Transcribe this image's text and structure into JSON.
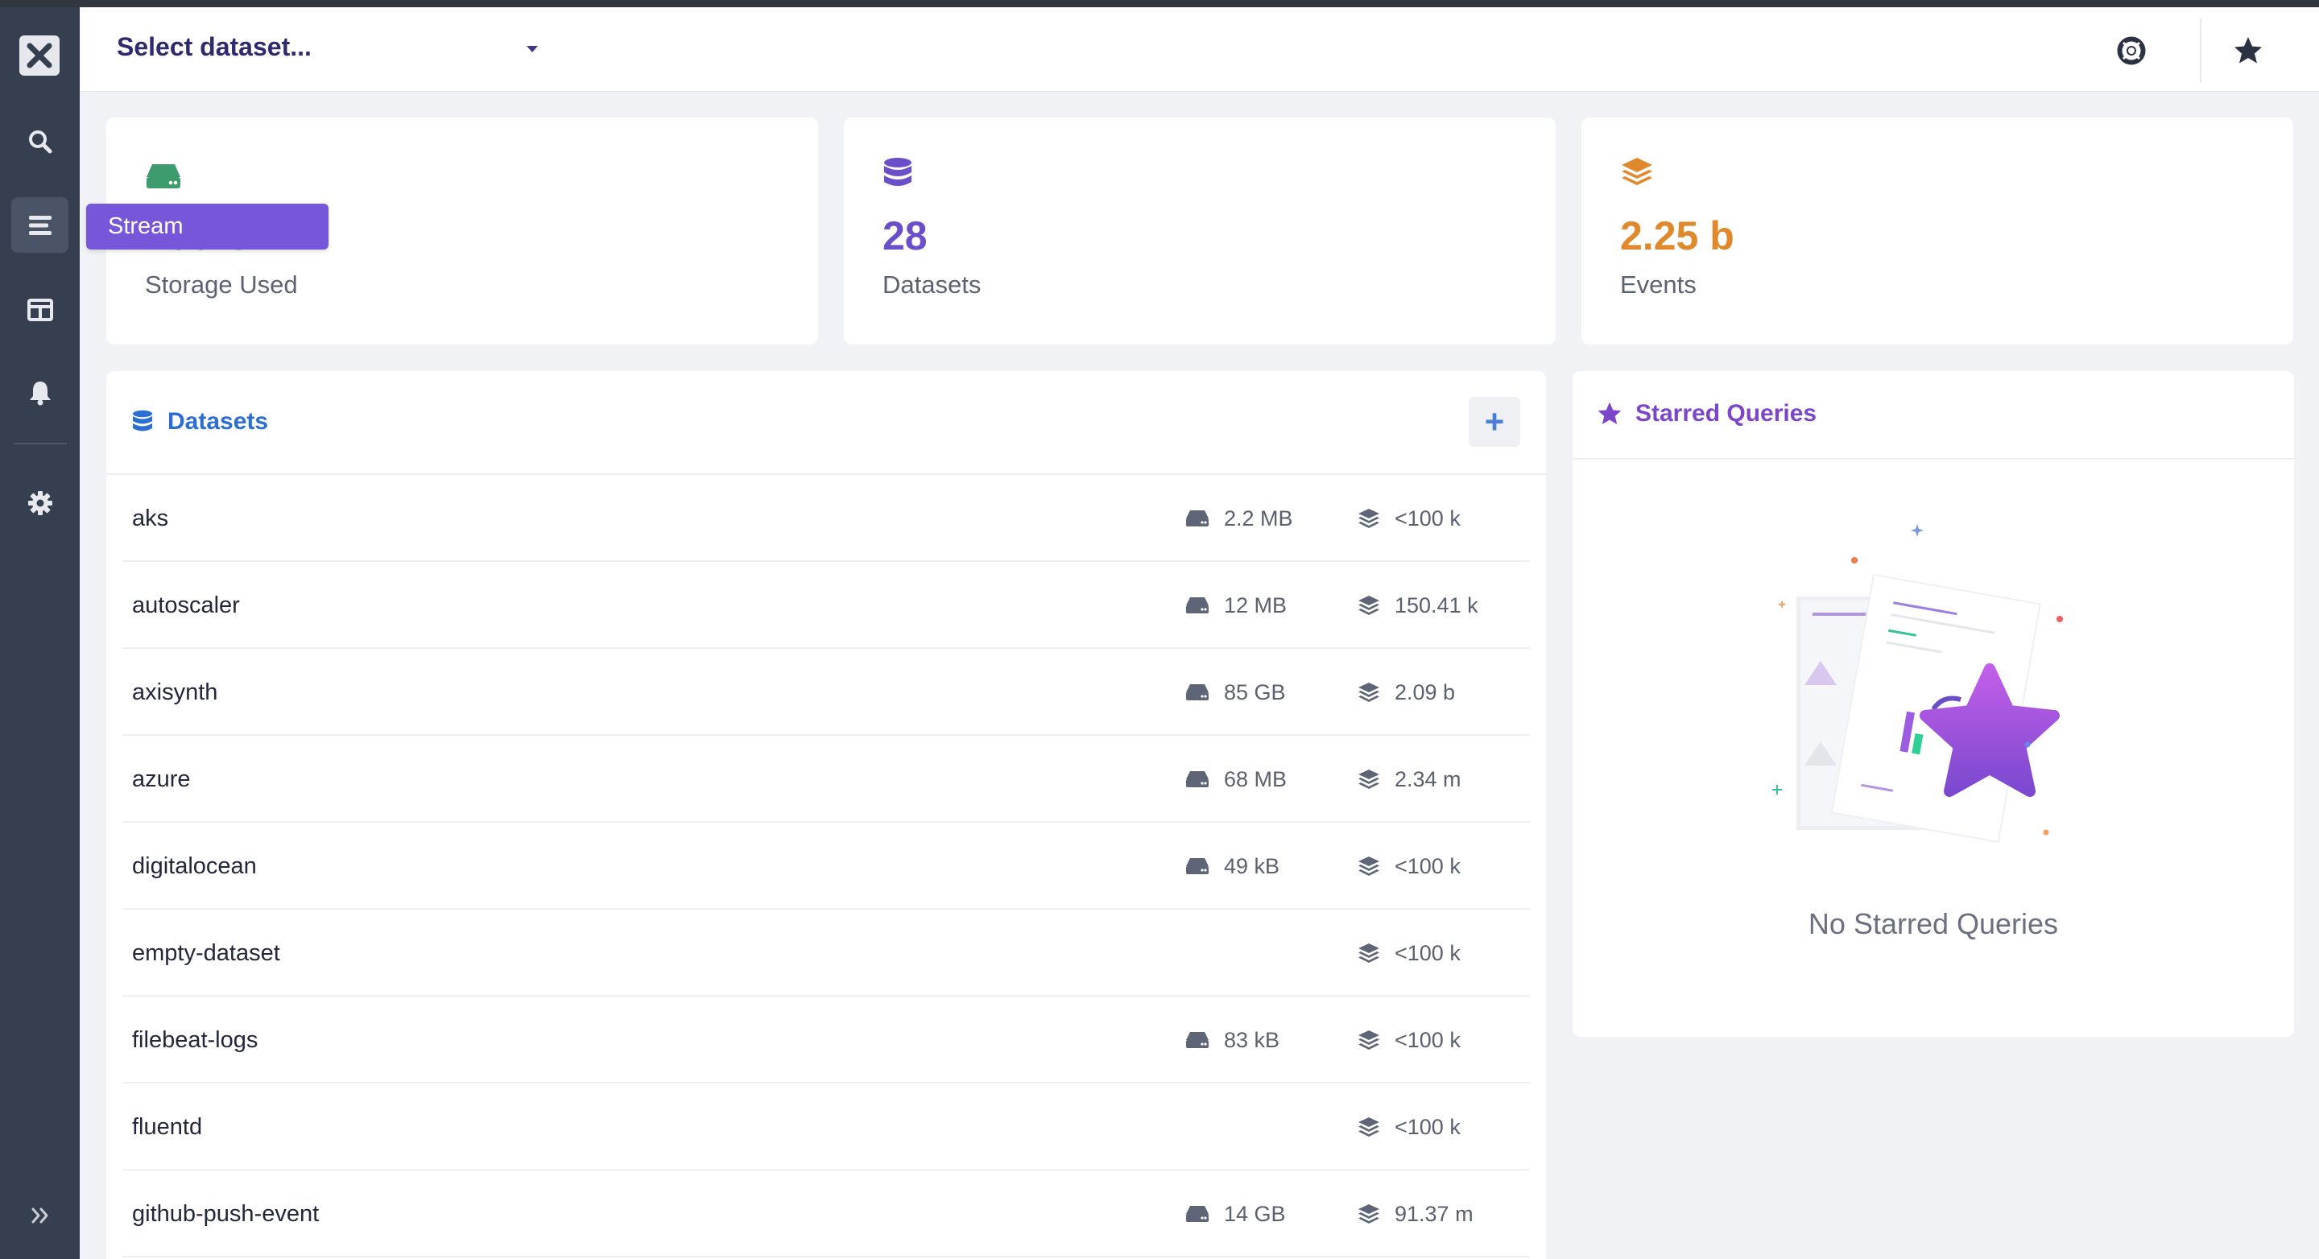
{
  "sidebar": {
    "items": [
      {
        "name": "search",
        "icon": "search-icon"
      },
      {
        "name": "stream",
        "icon": "stream-icon",
        "active": true
      },
      {
        "name": "dashboards",
        "icon": "dashboard-icon"
      },
      {
        "name": "monitors",
        "icon": "bell-icon"
      },
      {
        "name": "settings",
        "icon": "gear-icon"
      }
    ],
    "tooltip": "Stream",
    "expand_icon": "double-chevron-right-icon"
  },
  "header": {
    "dataset_placeholder": "Select dataset...",
    "help_icon": "help-icon",
    "star_icon": "star-icon"
  },
  "stats": [
    {
      "value": "400 GB",
      "label": "Storage Used",
      "icon": "hdd-icon",
      "color": "#3d9b6d"
    },
    {
      "value": "28",
      "label": "Datasets",
      "icon": "database-icon",
      "color": "#6a4fc9"
    },
    {
      "value": "2.25 b",
      "label": "Events",
      "icon": "layers-icon",
      "color": "#e0892c"
    }
  ],
  "datasets": {
    "title": "Datasets",
    "add_label": "+",
    "rows": [
      {
        "name": "aks",
        "size": "2.2 MB",
        "events": "<100 k"
      },
      {
        "name": "autoscaler",
        "size": "12 MB",
        "events": "150.41 k"
      },
      {
        "name": "axisynth",
        "size": "85 GB",
        "events": "2.09 b"
      },
      {
        "name": "azure",
        "size": "68 MB",
        "events": "2.34 m"
      },
      {
        "name": "digitalocean",
        "size": "49 kB",
        "events": "<100 k"
      },
      {
        "name": "empty-dataset",
        "size": "",
        "events": "<100 k"
      },
      {
        "name": "filebeat-logs",
        "size": "83 kB",
        "events": "<100 k"
      },
      {
        "name": "fluentd",
        "size": "",
        "events": "<100 k"
      },
      {
        "name": "github-push-event",
        "size": "14 GB",
        "events": "91.37 m"
      }
    ]
  },
  "starred": {
    "title": "Starred Queries",
    "empty_text": "No Starred Queries"
  },
  "colors": {
    "sidebar_bg": "#363f4f",
    "accent_purple": "#7656d9",
    "link_blue": "#2a6ed1"
  }
}
